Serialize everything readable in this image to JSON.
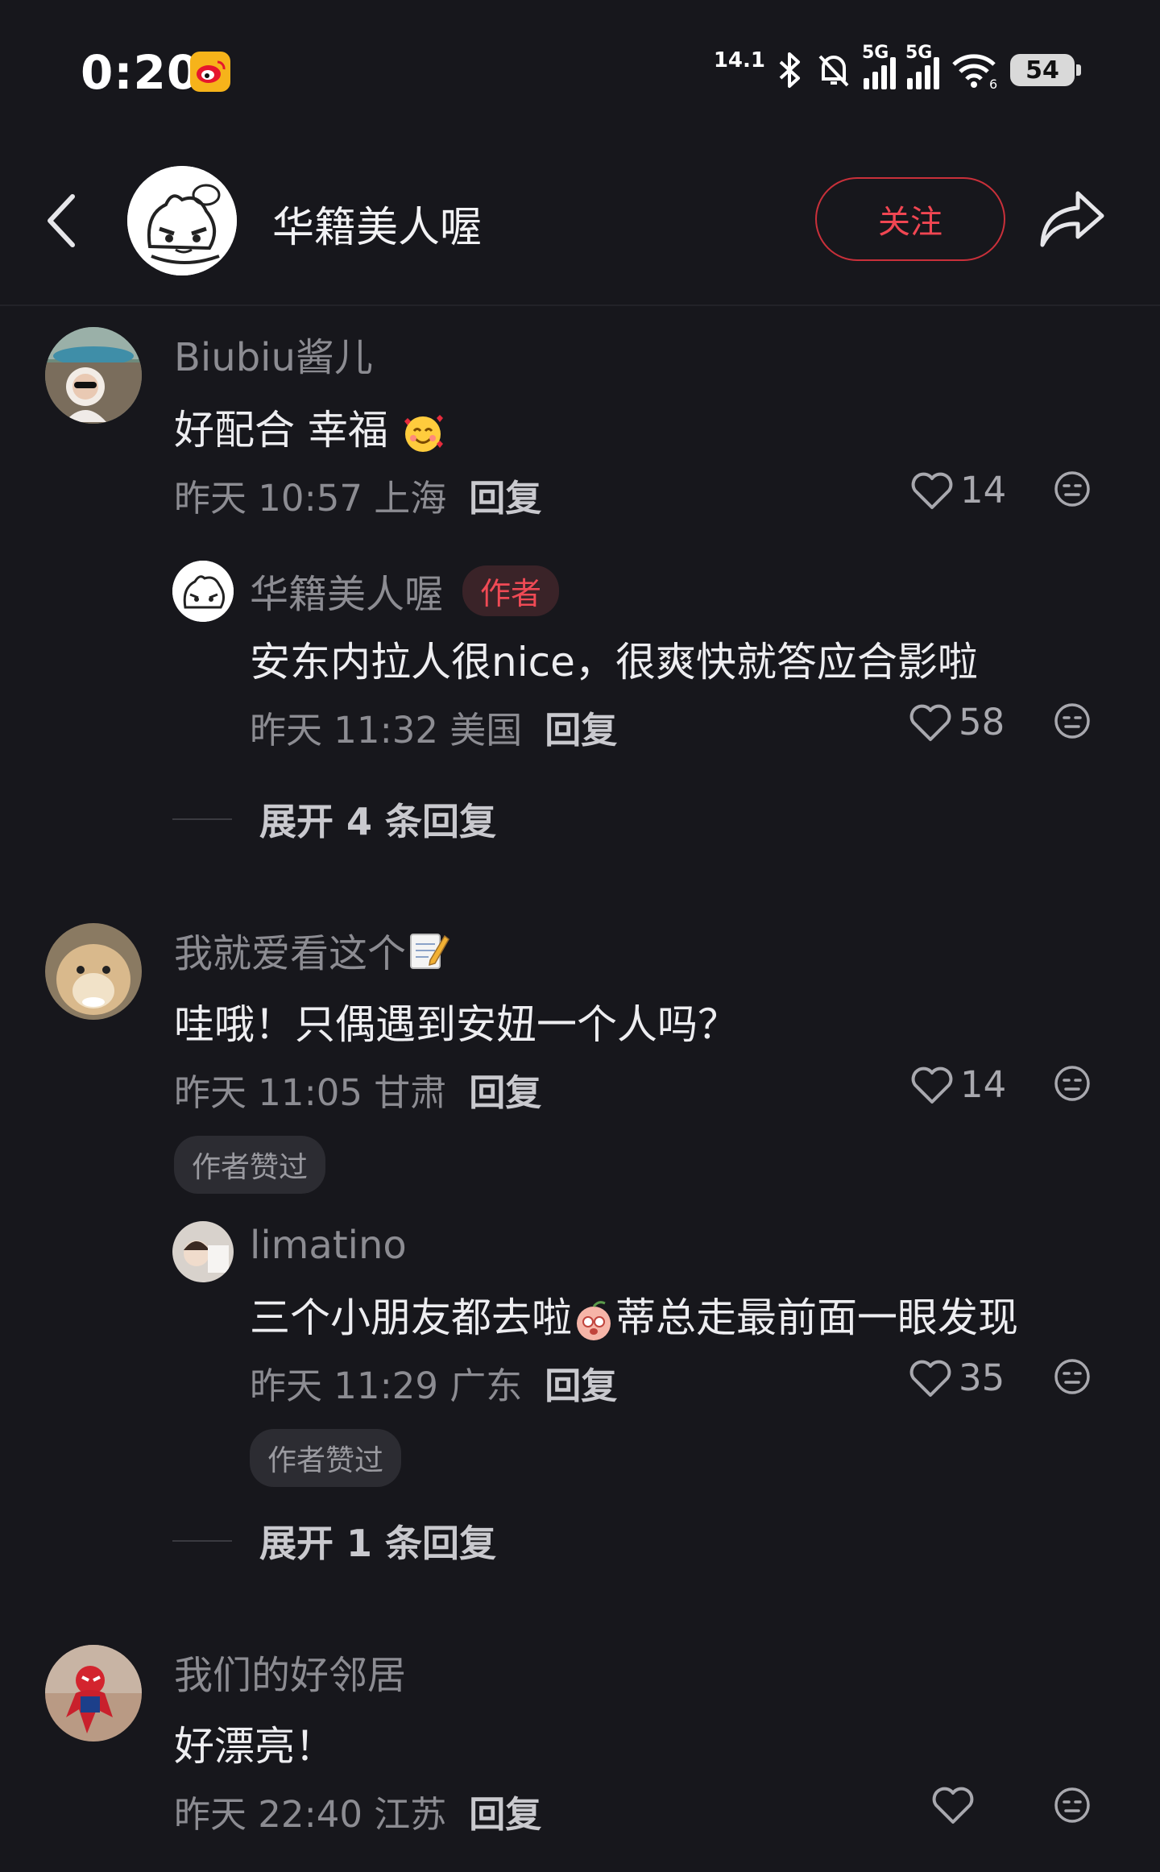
{
  "status_bar": {
    "time": "0:20",
    "net_speed": "14.1",
    "signal1_label": "5G",
    "signal2_label": "5G",
    "wifi_sub": "6",
    "battery": "54",
    "icons": [
      "weibo-icon",
      "bluetooth-icon",
      "mute-bell-icon",
      "signal-icon",
      "signal-icon",
      "wifi-icon",
      "battery-icon"
    ]
  },
  "header": {
    "name": "华籍美人喔",
    "follow_label": "关注"
  },
  "comments": [
    {
      "user": "Biubiu酱儿",
      "text": "好配合 幸福",
      "text_emoji": "smiling-face-with-hearts",
      "time": "昨天 10:57 上海",
      "reply_label": "回复",
      "likes": "14",
      "replies": [
        {
          "user": "华籍美人喔",
          "author_tag": "作者",
          "text": "安东内拉人很nice，很爽快就答应合影啦",
          "time": "昨天 11:32 美国",
          "reply_label": "回复",
          "likes": "58"
        }
      ],
      "expand_label": "展开 4 条回复"
    },
    {
      "user": "我就爱看这个",
      "user_emoji": "memo",
      "text": "哇哦！只偶遇到安妞一个人吗？",
      "time": "昨天 11:05 甘肃",
      "reply_label": "回复",
      "likes": "14",
      "liked_by_author": "作者赞过",
      "replies": [
        {
          "user": "limatino",
          "text_before": "三个小朋友都去啦",
          "text_emoji": "peach-face",
          "text_after": "蒂总走最前面一眼发现",
          "time": "昨天 11:29 广东",
          "reply_label": "回复",
          "likes": "35",
          "liked_by_author": "作者赞过"
        }
      ],
      "expand_label": "展开 1 条回复"
    },
    {
      "user": "我们的好邻居",
      "text": "好漂亮！",
      "time": "昨天 22:40 江苏",
      "reply_label": "回复",
      "likes": ""
    }
  ],
  "colors": {
    "background": "#17171c",
    "accent_red": "#f04652",
    "muted_text": "#8c8c92"
  }
}
